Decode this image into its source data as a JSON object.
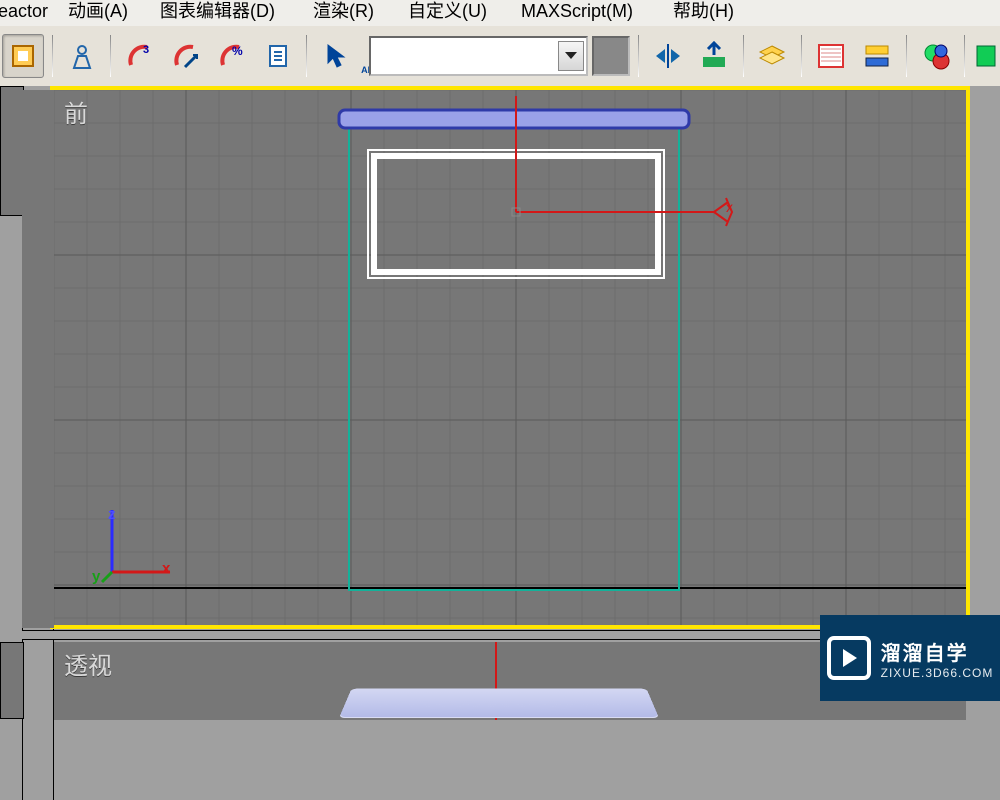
{
  "menu": {
    "items": [
      "eactor",
      "动画(A)",
      "图表编辑器(D)",
      "渲染(R)",
      "自定义(U)",
      "MAXScript(M)",
      "帮助(H)"
    ]
  },
  "toolbar": {
    "dropdown_value": "",
    "icons": {
      "sel_filter": "selection-filter",
      "sel_none": "select-none",
      "snap3": "snap-3d",
      "angle_snap": "angle-snap",
      "percent_snap": "percent-snap",
      "spinner_snap": "spinner-snap",
      "arrow": "select-object",
      "text": "abc",
      "mirror": "mirror",
      "align": "align",
      "layer": "layer-manager",
      "schematic": "schematic-view",
      "matl": "material-editor",
      "render_set": "render-setup",
      "render": "render"
    }
  },
  "viewports": {
    "front_label": "前",
    "perspective_label": "透视",
    "axes": {
      "x": "x",
      "y": "y",
      "z": "z"
    }
  },
  "watermark": {
    "title": "溜溜自学",
    "url": "ZIXUE.3D66.COM"
  }
}
